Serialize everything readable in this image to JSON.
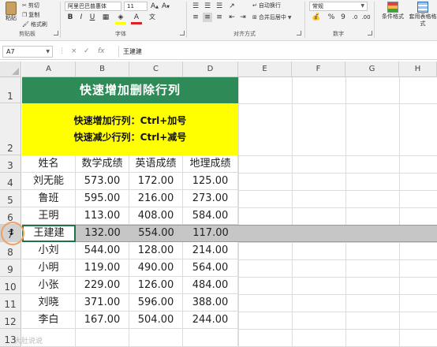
{
  "ribbon": {
    "clipboard": {
      "paste": "粘贴",
      "cut": "剪切",
      "copy": "复制",
      "format_painter": "格式刷",
      "group_label": "剪贴板"
    },
    "font": {
      "family": "阿里巴巴普惠体",
      "size": "11",
      "bold": "B",
      "italic": "I",
      "underline": "U",
      "group_label": "字体"
    },
    "alignment": {
      "wrap_text": "自动换行",
      "merge_center": "合并后居中",
      "group_label": "对齐方式"
    },
    "number": {
      "format": "常规",
      "percent": "%",
      "comma": "9",
      "group_label": "数字"
    },
    "styles": {
      "conditional_format": "条件格式",
      "format_as_table": "套用表格格式"
    }
  },
  "formula_bar": {
    "name_box": "A7",
    "cancel": "×",
    "enter": "✓",
    "fx": "fx",
    "content": "王建建"
  },
  "columns": [
    "A",
    "B",
    "C",
    "D",
    "E",
    "F",
    "G",
    "H"
  ],
  "rows": [
    "1",
    "2",
    "3",
    "4",
    "5",
    "6",
    "7",
    "8",
    "9",
    "10",
    "11",
    "12",
    "13"
  ],
  "sheet": {
    "title": "快速增加删除行列",
    "note1": "快速增加行列：Ctrl+加号",
    "note2": "快速减少行列：Ctrl+减号",
    "headers": [
      "姓名",
      "数学成绩",
      "英语成绩",
      "地理成绩"
    ],
    "records": [
      [
        "刘无能",
        "573.00",
        "172.00",
        "125.00"
      ],
      [
        "鲁班",
        "595.00",
        "216.00",
        "273.00"
      ],
      [
        "王明",
        "113.00",
        "408.00",
        "584.00"
      ],
      [
        "王建建",
        "132.00",
        "554.00",
        "117.00"
      ],
      [
        "小刘",
        "544.00",
        "128.00",
        "214.00"
      ],
      [
        "小明",
        "119.00",
        "490.00",
        "564.00"
      ],
      [
        "小张",
        "229.00",
        "126.00",
        "484.00"
      ],
      [
        "刘晓",
        "371.00",
        "596.00",
        "388.00"
      ],
      [
        "李白",
        "167.00",
        "504.00",
        "244.00"
      ]
    ]
  },
  "selection": {
    "active_row": "7",
    "active_cell": "A7"
  },
  "colors": {
    "title_bg": "#2e8b57",
    "note_bg": "#ffff00",
    "selection_band": "#c6c6c6",
    "excel_green": "#217346"
  },
  "watermark": "大肚说说"
}
